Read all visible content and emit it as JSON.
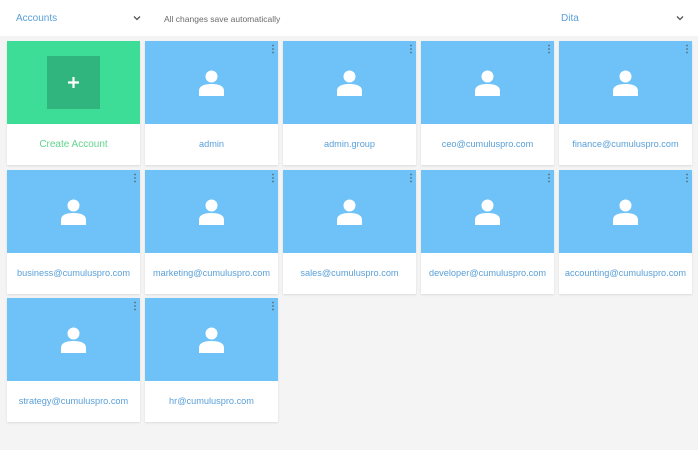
{
  "header": {
    "account_selector": "Accounts",
    "save_status": "All changes save automatically",
    "user_selector": "Dita"
  },
  "create_card": {
    "label": "Create Account"
  },
  "accounts": [
    {
      "label": "admin"
    },
    {
      "label": "admin.group"
    },
    {
      "label": "ceo@cumuluspro.com"
    },
    {
      "label": "finance@cumuluspro.com"
    },
    {
      "label": "business@cumuluspro.com"
    },
    {
      "label": "marketing@cumuluspro.com"
    },
    {
      "label": "sales@cumuluspro.com"
    },
    {
      "label": "developer@cumuluspro.com"
    },
    {
      "label": "accounting@cumuluspro.com"
    },
    {
      "label": "strategy@cumuluspro.com"
    },
    {
      "label": "hr@cumuluspro.com"
    }
  ],
  "colors": {
    "accent_blue": "#5aa0d8",
    "card_blue": "#6ec2f7",
    "create_green": "#3ddc97",
    "create_green_dark": "#2fb57d",
    "create_label_green": "#62d48d"
  },
  "icons": {
    "card_avatar": "user-icon",
    "card_menu": "more-vertical-icon",
    "create": "plus-icon",
    "dropdown": "chevron-down-icon"
  }
}
